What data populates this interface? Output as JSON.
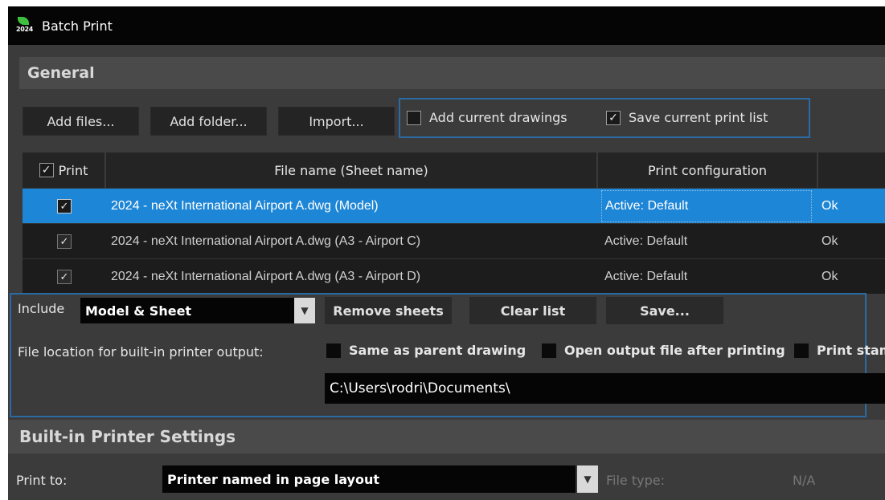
{
  "window": {
    "title": "Batch Print",
    "icon_text": "2024"
  },
  "general": {
    "header": "General",
    "buttons": {
      "add_files": "Add files...",
      "add_folder": "Add folder...",
      "import": "Import..."
    },
    "checkboxes": {
      "add_current_drawings": {
        "label": "Add current drawings",
        "checked": false
      },
      "save_current_print_list": {
        "label": "Save current print list",
        "checked": true
      }
    }
  },
  "table": {
    "columns": [
      "Print",
      "File name (Sheet name)",
      "Print configuration"
    ],
    "rows": [
      {
        "checked": true,
        "file": "2024 - neXt International Airport A.dwg (Model)",
        "config": "Active: Default",
        "status": "Ok",
        "selected": true
      },
      {
        "checked": true,
        "file": "2024 - neXt International Airport A.dwg (A3 - Airport C)",
        "config": "Active: Default",
        "status": "Ok",
        "selected": false
      },
      {
        "checked": true,
        "file": "2024 - neXt International Airport A.dwg (A3 - Airport D)",
        "config": "Active: Default",
        "status": "Ok",
        "selected": false
      }
    ]
  },
  "include": {
    "label": "Include",
    "value": "Model & Sheet",
    "buttons": {
      "remove_sheets": "Remove sheets",
      "clear_list": "Clear list",
      "save": "Save..."
    },
    "file_location_label": "File location for built-in printer output:",
    "options": {
      "same_as_parent": "Same as parent drawing",
      "open_output": "Open output file after printing",
      "print_stamp": "Print stam"
    },
    "path": "C:\\Users\\rodri\\Documents\\"
  },
  "printer_settings": {
    "header": "Built-in Printer Settings",
    "print_to_label": "Print to:",
    "print_to_value": "Printer named in page layout",
    "file_type_label": "File type:",
    "file_type_value": "N/A"
  },
  "colors": {
    "selection": "#1e86d6",
    "focus_border": "#2b6aa3",
    "panel_bg": "#3b3b3b"
  }
}
